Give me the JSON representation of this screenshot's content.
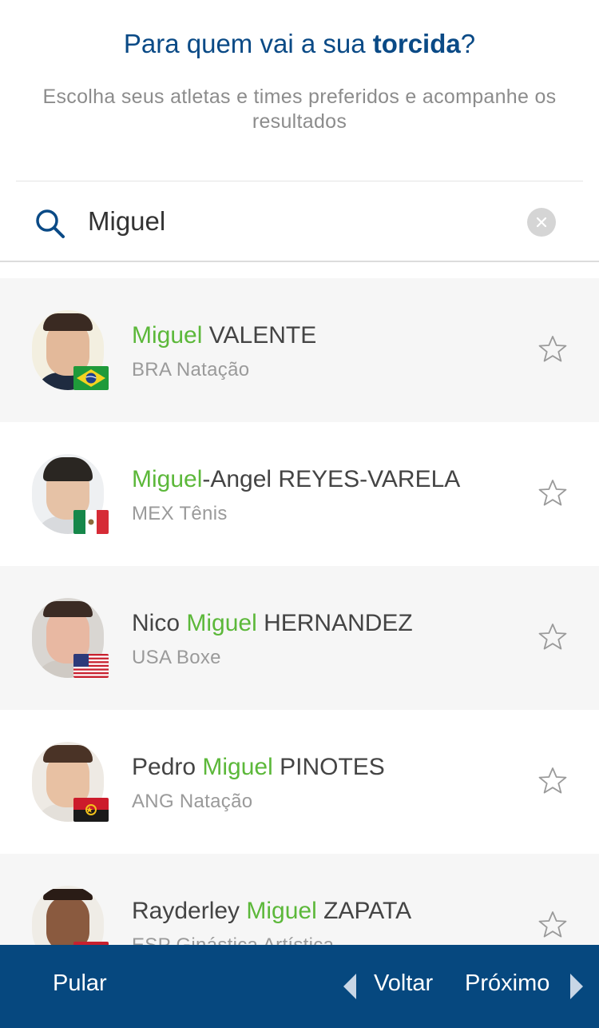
{
  "header": {
    "title_prefix": "Para quem vai a sua ",
    "title_bold": "torcida",
    "title_suffix": "?",
    "subtitle": "Escolha seus atletas e times preferidos e acompanhe os resultados"
  },
  "search": {
    "value": "Miguel",
    "icon": "search-icon",
    "clear_icon": "clear-icon"
  },
  "results": [
    {
      "name_before": "",
      "name_match": "Miguel",
      "name_after": " VALENTE",
      "country": "BRA",
      "sport": "Natação",
      "meta": "BRA Natação",
      "flag": "brazil-flag"
    },
    {
      "name_before": "",
      "name_match": "Miguel",
      "name_after": "-Angel REYES-VARELA",
      "country": "MEX",
      "sport": "Tênis",
      "meta": "MEX Tênis",
      "flag": "mexico-flag"
    },
    {
      "name_before": "Nico ",
      "name_match": "Miguel",
      "name_after": " HERNANDEZ",
      "country": "USA",
      "sport": "Boxe",
      "meta": "USA Boxe",
      "flag": "usa-flag"
    },
    {
      "name_before": "Pedro ",
      "name_match": "Miguel",
      "name_after": " PINOTES",
      "country": "ANG",
      "sport": "Natação",
      "meta": "ANG Natação",
      "flag": "angola-flag"
    },
    {
      "name_before": "Rayderley ",
      "name_match": "Miguel",
      "name_after": " ZAPATA",
      "country": "ESP",
      "sport": "Ginástica Artística",
      "meta": "ESP Ginástica Artística",
      "flag": "spain-flag"
    }
  ],
  "footer": {
    "skip_label": "Pular",
    "back_label": "Voltar",
    "next_label": "Próximo"
  },
  "colors": {
    "brand_blue": "#06487f",
    "title_blue": "#0a4a86",
    "highlight_green": "#5cb83a",
    "row_alt": "#f6f6f6"
  }
}
